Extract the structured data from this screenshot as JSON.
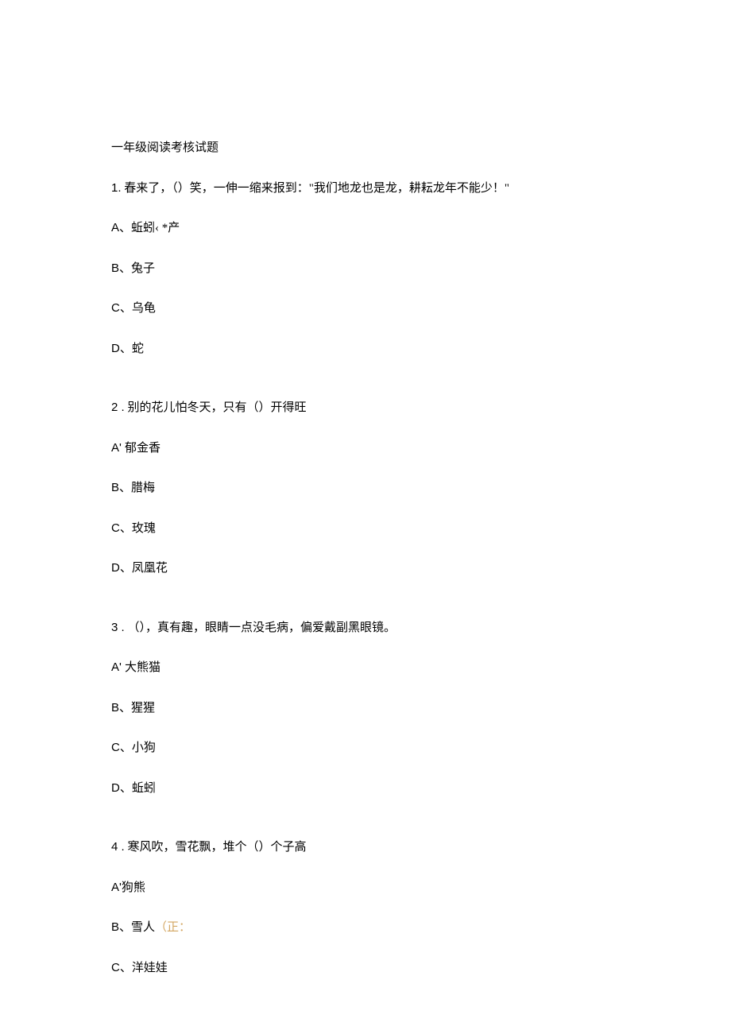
{
  "title": "一年级阅读考核试题",
  "questions": [
    {
      "number": "1.",
      "text": "春来了，（）笑，一伸一缩来报到：\"我们地龙也是龙，耕耘龙年不能少！\"",
      "options": [
        {
          "label": "A、",
          "text": "蚯蚓‹ *产"
        },
        {
          "label": "B、",
          "text": "兔子"
        },
        {
          "label": "C、",
          "text": "乌龟"
        },
        {
          "label": "D、",
          "text": "蛇"
        }
      ]
    },
    {
      "number": "2 .",
      "text": "别的花儿怕冬天，只有（）开得旺",
      "options": [
        {
          "label": "A' ",
          "text": "郁金香"
        },
        {
          "label": "B、",
          "text": "腊梅"
        },
        {
          "label": "C、",
          "text": "玫瑰"
        },
        {
          "label": "D、",
          "text": "凤凰花"
        }
      ]
    },
    {
      "number": "3 .",
      "text": "（），真有趣，眼睛一点没毛病，偏爱戴副黑眼镜。",
      "options": [
        {
          "label": "A' ",
          "text": "大熊猫"
        },
        {
          "label": "B、",
          "text": "猩猩"
        },
        {
          "label": "C、",
          "text": "小狗"
        },
        {
          "label": "D、",
          "text": "蚯蚓"
        }
      ]
    },
    {
      "number": "4 .",
      "text": "寒风吹，雪花飘，堆个（）个子高",
      "options": [
        {
          "label": "A'",
          "text": "狗熊"
        },
        {
          "label": "B、",
          "text": "雪人",
          "mark": "（正："
        },
        {
          "label": "C、",
          "text": "洋娃娃"
        }
      ]
    }
  ]
}
